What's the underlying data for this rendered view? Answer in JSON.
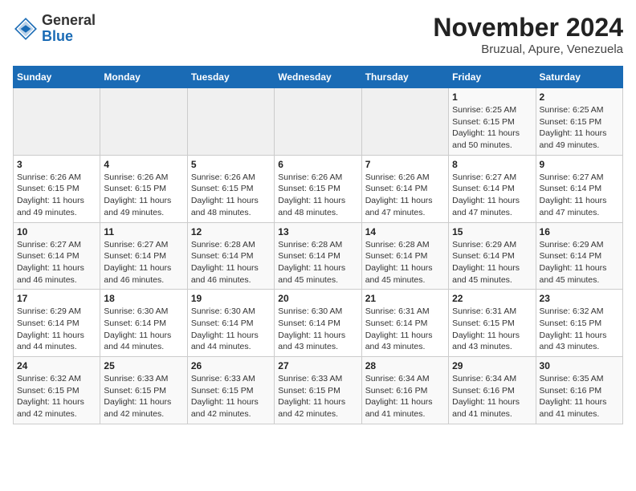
{
  "logo": {
    "general": "General",
    "blue": "Blue"
  },
  "title": "November 2024",
  "subtitle": "Bruzual, Apure, Venezuela",
  "days_of_week": [
    "Sunday",
    "Monday",
    "Tuesday",
    "Wednesday",
    "Thursday",
    "Friday",
    "Saturday"
  ],
  "weeks": [
    [
      {
        "day": "",
        "info": ""
      },
      {
        "day": "",
        "info": ""
      },
      {
        "day": "",
        "info": ""
      },
      {
        "day": "",
        "info": ""
      },
      {
        "day": "",
        "info": ""
      },
      {
        "day": "1",
        "info": "Sunrise: 6:25 AM\nSunset: 6:15 PM\nDaylight: 11 hours and 50 minutes."
      },
      {
        "day": "2",
        "info": "Sunrise: 6:25 AM\nSunset: 6:15 PM\nDaylight: 11 hours and 49 minutes."
      }
    ],
    [
      {
        "day": "3",
        "info": "Sunrise: 6:26 AM\nSunset: 6:15 PM\nDaylight: 11 hours and 49 minutes."
      },
      {
        "day": "4",
        "info": "Sunrise: 6:26 AM\nSunset: 6:15 PM\nDaylight: 11 hours and 49 minutes."
      },
      {
        "day": "5",
        "info": "Sunrise: 6:26 AM\nSunset: 6:15 PM\nDaylight: 11 hours and 48 minutes."
      },
      {
        "day": "6",
        "info": "Sunrise: 6:26 AM\nSunset: 6:15 PM\nDaylight: 11 hours and 48 minutes."
      },
      {
        "day": "7",
        "info": "Sunrise: 6:26 AM\nSunset: 6:14 PM\nDaylight: 11 hours and 47 minutes."
      },
      {
        "day": "8",
        "info": "Sunrise: 6:27 AM\nSunset: 6:14 PM\nDaylight: 11 hours and 47 minutes."
      },
      {
        "day": "9",
        "info": "Sunrise: 6:27 AM\nSunset: 6:14 PM\nDaylight: 11 hours and 47 minutes."
      }
    ],
    [
      {
        "day": "10",
        "info": "Sunrise: 6:27 AM\nSunset: 6:14 PM\nDaylight: 11 hours and 46 minutes."
      },
      {
        "day": "11",
        "info": "Sunrise: 6:27 AM\nSunset: 6:14 PM\nDaylight: 11 hours and 46 minutes."
      },
      {
        "day": "12",
        "info": "Sunrise: 6:28 AM\nSunset: 6:14 PM\nDaylight: 11 hours and 46 minutes."
      },
      {
        "day": "13",
        "info": "Sunrise: 6:28 AM\nSunset: 6:14 PM\nDaylight: 11 hours and 45 minutes."
      },
      {
        "day": "14",
        "info": "Sunrise: 6:28 AM\nSunset: 6:14 PM\nDaylight: 11 hours and 45 minutes."
      },
      {
        "day": "15",
        "info": "Sunrise: 6:29 AM\nSunset: 6:14 PM\nDaylight: 11 hours and 45 minutes."
      },
      {
        "day": "16",
        "info": "Sunrise: 6:29 AM\nSunset: 6:14 PM\nDaylight: 11 hours and 45 minutes."
      }
    ],
    [
      {
        "day": "17",
        "info": "Sunrise: 6:29 AM\nSunset: 6:14 PM\nDaylight: 11 hours and 44 minutes."
      },
      {
        "day": "18",
        "info": "Sunrise: 6:30 AM\nSunset: 6:14 PM\nDaylight: 11 hours and 44 minutes."
      },
      {
        "day": "19",
        "info": "Sunrise: 6:30 AM\nSunset: 6:14 PM\nDaylight: 11 hours and 44 minutes."
      },
      {
        "day": "20",
        "info": "Sunrise: 6:30 AM\nSunset: 6:14 PM\nDaylight: 11 hours and 43 minutes."
      },
      {
        "day": "21",
        "info": "Sunrise: 6:31 AM\nSunset: 6:14 PM\nDaylight: 11 hours and 43 minutes."
      },
      {
        "day": "22",
        "info": "Sunrise: 6:31 AM\nSunset: 6:15 PM\nDaylight: 11 hours and 43 minutes."
      },
      {
        "day": "23",
        "info": "Sunrise: 6:32 AM\nSunset: 6:15 PM\nDaylight: 11 hours and 43 minutes."
      }
    ],
    [
      {
        "day": "24",
        "info": "Sunrise: 6:32 AM\nSunset: 6:15 PM\nDaylight: 11 hours and 42 minutes."
      },
      {
        "day": "25",
        "info": "Sunrise: 6:33 AM\nSunset: 6:15 PM\nDaylight: 11 hours and 42 minutes."
      },
      {
        "day": "26",
        "info": "Sunrise: 6:33 AM\nSunset: 6:15 PM\nDaylight: 11 hours and 42 minutes."
      },
      {
        "day": "27",
        "info": "Sunrise: 6:33 AM\nSunset: 6:15 PM\nDaylight: 11 hours and 42 minutes."
      },
      {
        "day": "28",
        "info": "Sunrise: 6:34 AM\nSunset: 6:16 PM\nDaylight: 11 hours and 41 minutes."
      },
      {
        "day": "29",
        "info": "Sunrise: 6:34 AM\nSunset: 6:16 PM\nDaylight: 11 hours and 41 minutes."
      },
      {
        "day": "30",
        "info": "Sunrise: 6:35 AM\nSunset: 6:16 PM\nDaylight: 11 hours and 41 minutes."
      }
    ]
  ]
}
